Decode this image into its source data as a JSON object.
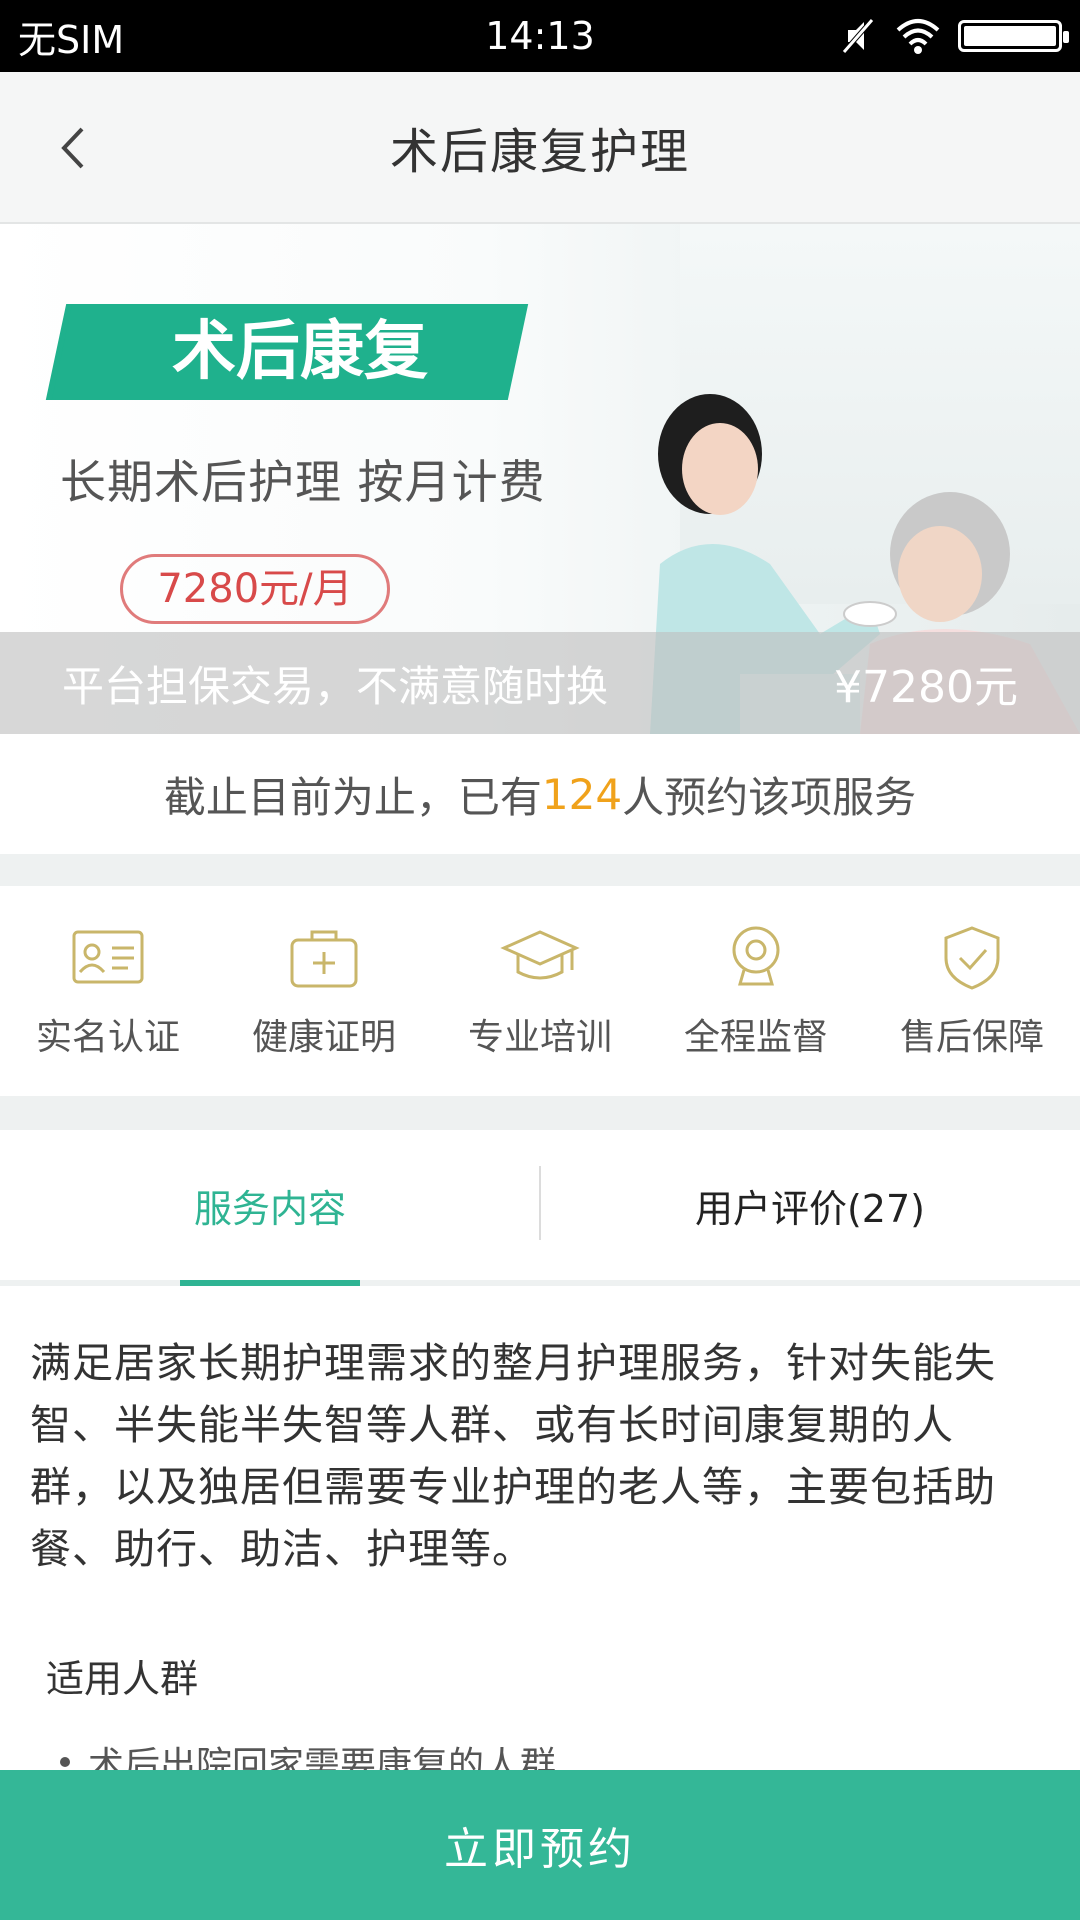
{
  "status_bar": {
    "carrier": "无SIM",
    "time": "14:13"
  },
  "nav": {
    "title": "术后康复护理"
  },
  "banner": {
    "tag": "术后康复",
    "subtitle": "长期术后护理 按月计费",
    "price_badge": "7280元/月",
    "overlay_left": "平台担保交易，不满意随时换",
    "overlay_right": "¥7280元"
  },
  "stat": {
    "prefix": "截止目前为止，已有",
    "count": "124",
    "suffix": "人预约该项服务"
  },
  "features": [
    {
      "label": "实名认证",
      "icon": "id-card-icon"
    },
    {
      "label": "健康证明",
      "icon": "medical-kit-icon"
    },
    {
      "label": "专业培训",
      "icon": "graduation-cap-icon"
    },
    {
      "label": "全程监督",
      "icon": "camera-icon"
    },
    {
      "label": "售后保障",
      "icon": "shield-check-icon"
    }
  ],
  "tabs": [
    {
      "label": "服务内容"
    },
    {
      "label": "用户评价(27)"
    }
  ],
  "content": {
    "description": "满足居家长期护理需求的整月护理服务，针对失能失智、半失能半失智等人群、或有长时间康复期的人群，以及独居但需要专业护理的老人等，主要包括助餐、助行、助洁、护理等。",
    "section_title": "适用人群",
    "bullet_1": "术后出院回家需要康复的人群"
  },
  "cta": {
    "label": "立即预约"
  },
  "colors": {
    "accent": "#34b797",
    "highlight": "#f0a21b",
    "icon": "#c9b66a"
  }
}
